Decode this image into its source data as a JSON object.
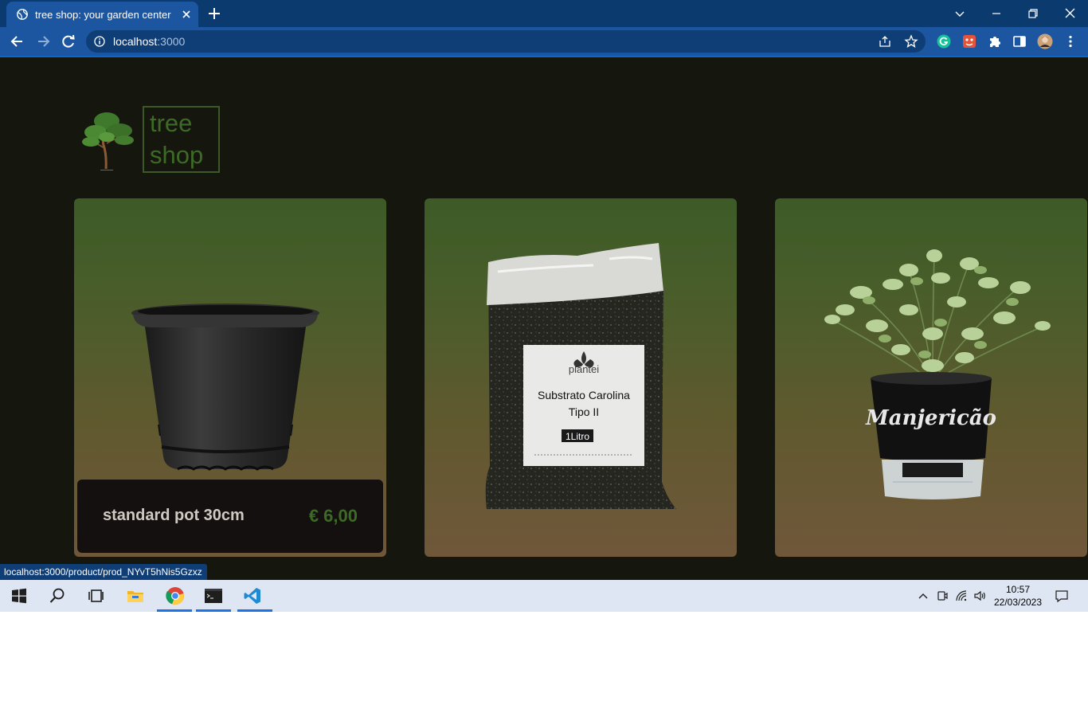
{
  "browser": {
    "tab_title": "tree shop: your garden center",
    "url_host": "localhost",
    "url_port": ":3000",
    "status_url": "localhost:3000/product/prod_NYvT5hNis5Gzxz"
  },
  "site": {
    "logo_line1": "tree",
    "logo_line2": "shop"
  },
  "products": [
    {
      "name": "standard pot 30cm",
      "price": "€ 6,00"
    },
    {
      "bag_brand": "plantei",
      "bag_title_line1": "Substrato Carolina",
      "bag_title_line2": "Tipo II",
      "bag_volume": "1Litro"
    },
    {
      "pot_label": "Manjericão"
    }
  ],
  "taskbar": {
    "time": "10:57",
    "date": "22/03/2023"
  },
  "colors": {
    "page_bg": "#15170e",
    "accent_green": "#3d6a26",
    "browser_blue": "#1c56a0"
  }
}
